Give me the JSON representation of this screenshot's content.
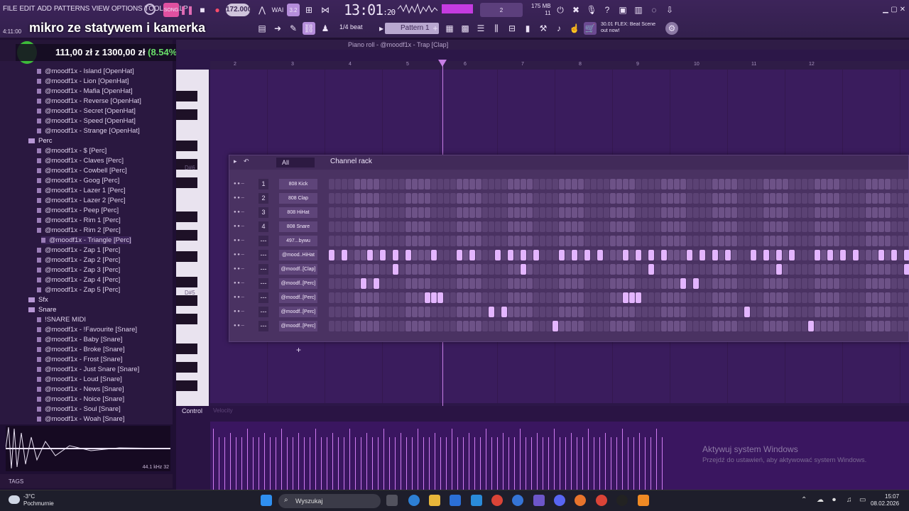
{
  "menu": [
    "FILE",
    "EDIT",
    "ADD",
    "PATTERNS",
    "VIEW",
    "OPTIONS",
    "TOOLS",
    "HELP"
  ],
  "tempo": "172.000",
  "clock": {
    "main": "13:01",
    "sub": ":20",
    "beat": "B:S:T"
  },
  "memory": {
    "mb": "175 MB",
    "voices": "11",
    "cpu": "2"
  },
  "snap": "1/4 beat",
  "pattern": "Pattern 1",
  "news": {
    "line1": "30.01  FLEX: Beat Scene",
    "line2": "out now!"
  },
  "time_small": "4:11:00",
  "overlay": {
    "title": "mikro ze statywem i kamerka",
    "money": "111,00 zł z 1300,00 zł",
    "percent": "(8.54%)"
  },
  "browser": {
    "items": [
      {
        "label": "@moodf1x - Island [OpenHat]",
        "type": "file"
      },
      {
        "label": "@moodf1x - Lion [OpenHat]",
        "type": "file"
      },
      {
        "label": "@moodf1x - Mafia [OpenHat]",
        "type": "file"
      },
      {
        "label": "@moodf1x - Reverse [OpenHat]",
        "type": "file"
      },
      {
        "label": "@moodf1x - Secret [OpenHat]",
        "type": "file"
      },
      {
        "label": "@moodf1x - Speed [OpenHat]",
        "type": "file"
      },
      {
        "label": "@moodf1x - Strange [OpenHat]",
        "type": "file"
      },
      {
        "label": "Perc",
        "type": "folder"
      },
      {
        "label": "@moodf1x - $ [Perc]",
        "type": "file"
      },
      {
        "label": "@moodf1x - Claves [Perc]",
        "type": "file"
      },
      {
        "label": "@moodf1x - Cowbell [Perc]",
        "type": "file"
      },
      {
        "label": "@moodf1x - Goog [Perc]",
        "type": "file"
      },
      {
        "label": "@moodf1x - Lazer 1 [Perc]",
        "type": "file"
      },
      {
        "label": "@moodf1x - Lazer 2 [Perc]",
        "type": "file"
      },
      {
        "label": "@moodf1x - Peep [Perc]",
        "type": "file"
      },
      {
        "label": "@moodf1x - Rim 1 [Perc]",
        "type": "file"
      },
      {
        "label": "@moodf1x - Rim 2 [Perc]",
        "type": "file"
      },
      {
        "label": "@moodf1x - Triangle [Perc]",
        "type": "selected"
      },
      {
        "label": "@moodf1x - Zap 1 [Perc]",
        "type": "file"
      },
      {
        "label": "@moodf1x - Zap 2 [Perc]",
        "type": "file"
      },
      {
        "label": "@moodf1x - Zap 3 [Perc]",
        "type": "file"
      },
      {
        "label": "@moodf1x - Zap 4 [Perc]",
        "type": "file"
      },
      {
        "label": "@moodf1x - Zap 5 [Perc]",
        "type": "file"
      },
      {
        "label": "Sfx",
        "type": "folder"
      },
      {
        "label": "Snare",
        "type": "folder"
      },
      {
        "label": "!SNARE MIDI",
        "type": "file"
      },
      {
        "label": "@moodf1x - !Favourite [Snare]",
        "type": "file"
      },
      {
        "label": "@moodf1x - Baby [Snare]",
        "type": "file"
      },
      {
        "label": "@moodf1x - Broke [Snare]",
        "type": "file"
      },
      {
        "label": "@moodf1x - Frost [Snare]",
        "type": "file"
      },
      {
        "label": "@moodf1x - Just Snare [Snare]",
        "type": "file"
      },
      {
        "label": "@moodf1x - Loud [Snare]",
        "type": "file"
      },
      {
        "label": "@moodf1x - News [Snare]",
        "type": "file"
      },
      {
        "label": "@moodf1x - Noice [Snare]",
        "type": "file"
      },
      {
        "label": "@moodf1x - Soul [Snare]",
        "type": "file"
      },
      {
        "label": "@moodf1x - Woah [Snare]",
        "type": "file"
      }
    ],
    "sample_info": "44.1 kHz 32",
    "tags_label": "TAGS"
  },
  "pianoroll": {
    "title": "Piano roll - @moodf1x - Trap [Clap]",
    "key_labels": [
      "D#6",
      "D#5"
    ],
    "ruler": [
      "2",
      "3",
      "4",
      "5",
      "6",
      "7",
      "8",
      "9",
      "10",
      "11",
      "12"
    ],
    "control_label": "Control",
    "control_sub": "Velocity"
  },
  "rack": {
    "filter": "All",
    "title": "Channel rack",
    "channels": [
      {
        "num": "1",
        "name": "808 Kick",
        "steps": []
      },
      {
        "num": "2",
        "name": "808 Clap",
        "steps": []
      },
      {
        "num": "3",
        "name": "808 HiHat",
        "steps": []
      },
      {
        "num": "4",
        "name": "808 Snare",
        "steps": []
      },
      {
        "num": "---",
        "name": "497...bywu",
        "steps": []
      },
      {
        "num": "---",
        "name": "@mood..HiHat",
        "steps": [
          0,
          2,
          6,
          8,
          10,
          12,
          16,
          20,
          22,
          26,
          28,
          30,
          32,
          36,
          38,
          40,
          42,
          46,
          48,
          50,
          52,
          56,
          58,
          60,
          62,
          66,
          68,
          70,
          72,
          76,
          78,
          80,
          82,
          86,
          88,
          90
        ]
      },
      {
        "num": "---",
        "name": "@moodf..[Clap]",
        "steps": [
          10,
          30,
          50,
          70,
          90
        ]
      },
      {
        "num": "---",
        "name": "@moodf..[Perc]",
        "steps": [
          5,
          7,
          55,
          57
        ]
      },
      {
        "num": "---",
        "name": "@moodf..[Perc]",
        "steps": [
          15,
          16,
          17,
          46,
          47,
          48
        ]
      },
      {
        "num": "---",
        "name": "@moodf..[Perc]",
        "steps": [
          25,
          27,
          65
        ]
      },
      {
        "num": "---",
        "name": "@moodf..[Perc]",
        "steps": [
          35,
          75
        ]
      }
    ]
  },
  "velocity_count": 80,
  "activate": {
    "title": "Aktywuj system Windows",
    "sub": "Przejdź do ustawień, aby aktywować system Windows."
  },
  "taskbar": {
    "weather_temp": "-3°C",
    "weather_desc": "Pochmurnie",
    "search": "Wyszukaj",
    "time": "15:07",
    "date": "08.02.2026"
  }
}
